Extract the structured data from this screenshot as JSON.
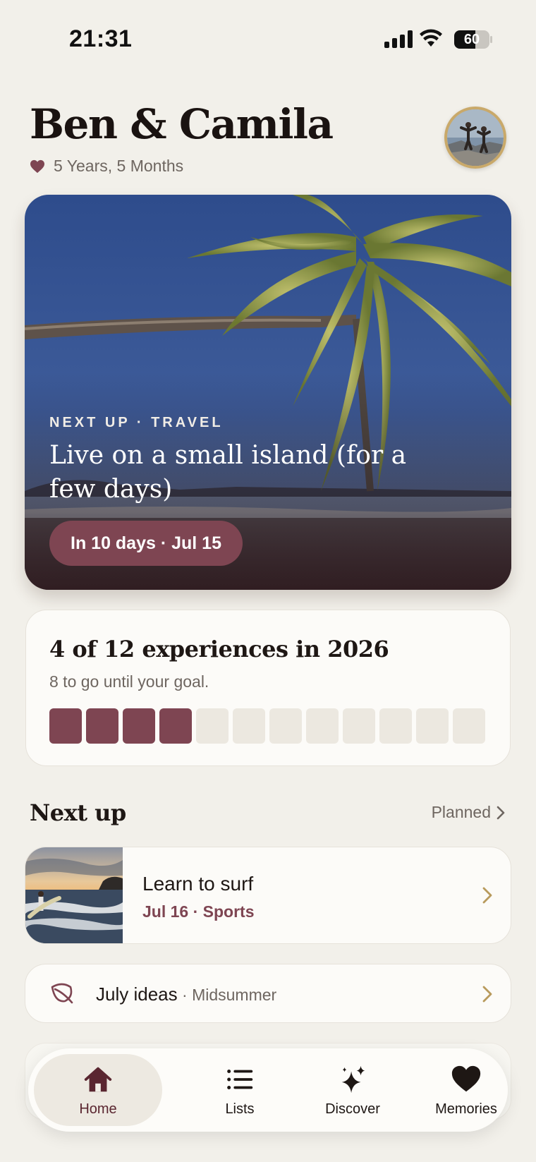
{
  "status": {
    "time": "21:31",
    "battery": "60",
    "battery_level": 0.6
  },
  "header": {
    "title": "Ben & Camila",
    "duration": "5 Years, 5 Months",
    "heart_icon": "heart-icon",
    "accent": "#7E4552"
  },
  "hero": {
    "kicker": "NEXT UP · TRAVEL",
    "headline": "Live on a small island (for a few days)",
    "pill": "In 10 days · Jul 15"
  },
  "progress": {
    "title": "4 of 12 experiences in 2026",
    "subtitle": "8 to go until your goal.",
    "completed": 4,
    "total": 12
  },
  "next_up": {
    "heading": "Next up",
    "link": "Planned"
  },
  "items": [
    {
      "title": "Learn to surf",
      "meta": "Jul 16 · Sports"
    },
    {
      "title": "July ideas",
      "meta": "Midsummer",
      "icon": "leaf-icon"
    }
  ],
  "tabs": [
    {
      "label": "Home",
      "icon": "home-icon"
    },
    {
      "label": "Lists",
      "icon": "list-icon"
    },
    {
      "label": "Discover",
      "icon": "sparkle-icon"
    },
    {
      "label": "Memories",
      "icon": "heart-icon"
    }
  ]
}
